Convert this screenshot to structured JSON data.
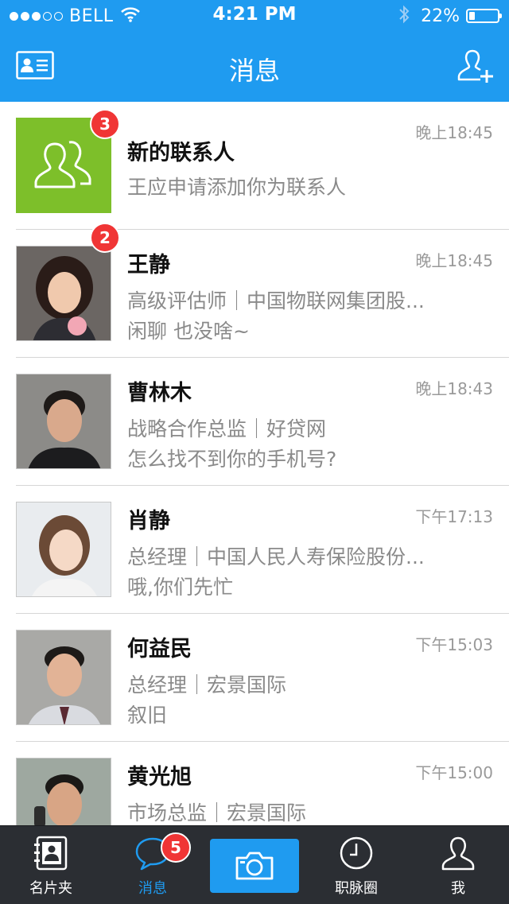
{
  "status_bar": {
    "carrier": "BELL",
    "time": "4:21 PM",
    "battery": "22%",
    "battery_level": 0.22,
    "signal_bars_filled": 3,
    "signal_bars_total": 5
  },
  "nav": {
    "title": "消息",
    "left_icon": "contact-card-icon",
    "right_icon": "add-contact-icon"
  },
  "messages": [
    {
      "name": "新的联系人",
      "line1": "王应申请添加你为联系人",
      "line2": "",
      "time": "晚上18:45",
      "badge": "3",
      "avatar": "contacts-group-icon"
    },
    {
      "name": "王静",
      "line1": "高级评估师｜中国物联网集团股...",
      "line2": "闲聊  也没啥~",
      "time": "晚上18:45",
      "badge": "2",
      "avatar": "photo"
    },
    {
      "name": "曹林木",
      "line1": "战略合作总监｜好贷网",
      "line2": "怎么找不到你的手机号?",
      "time": "晚上18:43",
      "badge": "",
      "avatar": "photo"
    },
    {
      "name": "肖静",
      "line1": "总经理｜中国人民人寿保险股份...",
      "line2": "哦,你们先忙",
      "time": "下午17:13",
      "badge": "",
      "avatar": "photo"
    },
    {
      "name": "何益民",
      "line1": "总经理｜宏景国际",
      "line2": "叙旧",
      "time": "下午15:03",
      "badge": "",
      "avatar": "photo"
    },
    {
      "name": "黄光旭",
      "line1": "市场总监｜宏景国际",
      "line2": "",
      "time": "下午15:00",
      "badge": "",
      "avatar": "photo"
    }
  ],
  "tabbar": {
    "tabs": [
      {
        "label": "名片夹",
        "icon": "address-book-icon"
      },
      {
        "label": "消息",
        "icon": "chat-bubble-icon",
        "badge": "5"
      },
      {
        "label": "",
        "icon": "camera-icon"
      },
      {
        "label": "职脉圈",
        "icon": "clock-icon"
      },
      {
        "label": "我",
        "icon": "person-icon"
      }
    ],
    "active_index": 1
  },
  "colors": {
    "accent": "#1f9bf0",
    "badge": "#f03535",
    "tabbar_bg": "#2b2e33",
    "new_contact_tile": "#7dbf2a"
  }
}
